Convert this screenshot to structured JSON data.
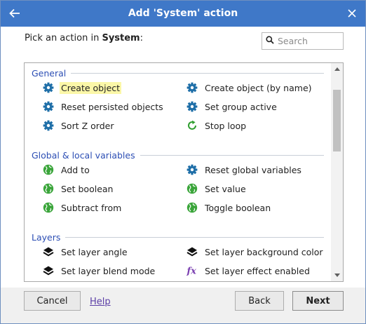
{
  "window": {
    "title": "Add 'System' action",
    "back_icon": "back-arrow-icon",
    "close_icon": "close-icon"
  },
  "prompt": {
    "prefix": "Pick an action in ",
    "object": "System",
    "suffix": ":"
  },
  "search": {
    "placeholder": "Search",
    "value": ""
  },
  "groups": [
    {
      "label": "General",
      "items": [
        {
          "label": "Create object",
          "icon": "gear-icon",
          "highlighted": true
        },
        {
          "label": "Create object (by name)",
          "icon": "gear-icon"
        },
        {
          "label": "Reset persisted objects",
          "icon": "gear-icon"
        },
        {
          "label": "Set group active",
          "icon": "gear-icon"
        },
        {
          "label": "Sort Z order",
          "icon": "gear-icon"
        },
        {
          "label": "Stop loop",
          "icon": "loop-icon"
        }
      ]
    },
    {
      "label": "Global & local variables",
      "items": [
        {
          "label": "Add to",
          "icon": "globe-icon"
        },
        {
          "label": "Reset global variables",
          "icon": "gear-icon"
        },
        {
          "label": "Set boolean",
          "icon": "globe-icon"
        },
        {
          "label": "Set value",
          "icon": "globe-icon"
        },
        {
          "label": "Subtract from",
          "icon": "globe-icon"
        },
        {
          "label": "Toggle boolean",
          "icon": "globe-icon"
        }
      ]
    },
    {
      "label": "Layers",
      "items": [
        {
          "label": "Set layer angle",
          "icon": "layers-icon"
        },
        {
          "label": "Set layer background color",
          "icon": "layers-icon"
        },
        {
          "label": "Set layer blend mode",
          "icon": "layers-icon"
        },
        {
          "label": "Set layer effect enabled",
          "icon": "function-icon"
        }
      ]
    }
  ],
  "footer": {
    "cancel": "Cancel",
    "help": "Help",
    "back": "Back",
    "next": "Next"
  },
  "colors": {
    "titlebar": "#3f78c8",
    "group_header": "#2c4eb4",
    "gear": "#1f6fa8",
    "globe": "#3aa53a",
    "loop": "#2e9e2e",
    "function": "#7a3fb0",
    "highlight": "#fbf7a8"
  }
}
